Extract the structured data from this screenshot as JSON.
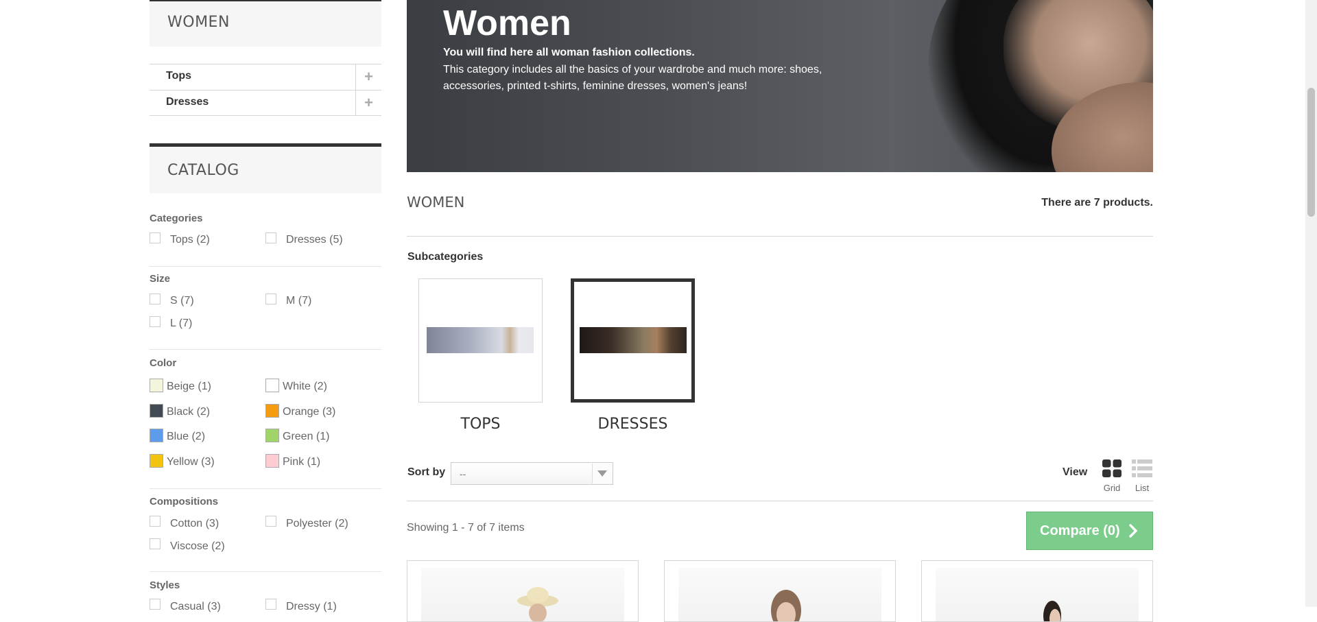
{
  "sidebar": {
    "category_block_title": "WOMEN",
    "category_items": [
      {
        "label": "Tops",
        "toggle": "+"
      },
      {
        "label": "Dresses",
        "toggle": "+"
      }
    ],
    "catalog_title": "CATALOG",
    "filters": {
      "categories": {
        "title": "Categories",
        "options": [
          "Tops (2)",
          "Dresses (5)"
        ]
      },
      "size": {
        "title": "Size",
        "options": [
          "S (7)",
          "M (7)",
          "L (7)"
        ]
      },
      "color": {
        "title": "Color",
        "options": [
          {
            "label": "Beige (1)",
            "color": "#f5f5dc"
          },
          {
            "label": "White (2)",
            "color": "#ffffff"
          },
          {
            "label": "Black (2)",
            "color": "#434a54"
          },
          {
            "label": "Orange (3)",
            "color": "#f39c11"
          },
          {
            "label": "Blue (2)",
            "color": "#5d9cec"
          },
          {
            "label": "Green (1)",
            "color": "#a0d468"
          },
          {
            "label": "Yellow (3)",
            "color": "#f1c40f"
          },
          {
            "label": "Pink (1)",
            "color": "#fcccd2"
          }
        ]
      },
      "compositions": {
        "title": "Compositions",
        "options": [
          "Cotton (3)",
          "Polyester (2)",
          "Viscose (2)"
        ]
      },
      "styles": {
        "title": "Styles",
        "options": [
          "Casual (3)",
          "Dressy (1)"
        ]
      }
    }
  },
  "banner": {
    "title": "Women",
    "subtitle": "You will find here all woman fashion collections.",
    "description": "This category includes all the basics of your wardrobe and much more: shoes, accessories, printed t-shirts, feminine dresses, women's jeans!"
  },
  "main": {
    "heading": "WOMEN",
    "product_count": "There are 7 products.",
    "subcategories_title": "Subcategories",
    "subcategories": [
      {
        "name": "TOPS"
      },
      {
        "name": "DRESSES"
      }
    ],
    "sort_label": "Sort by",
    "sort_value": "--",
    "view_label": "View",
    "view_grid": "Grid",
    "view_list": "List",
    "showing": "Showing 1 - 7 of 7 items",
    "compare_label": "Compare (0)"
  }
}
